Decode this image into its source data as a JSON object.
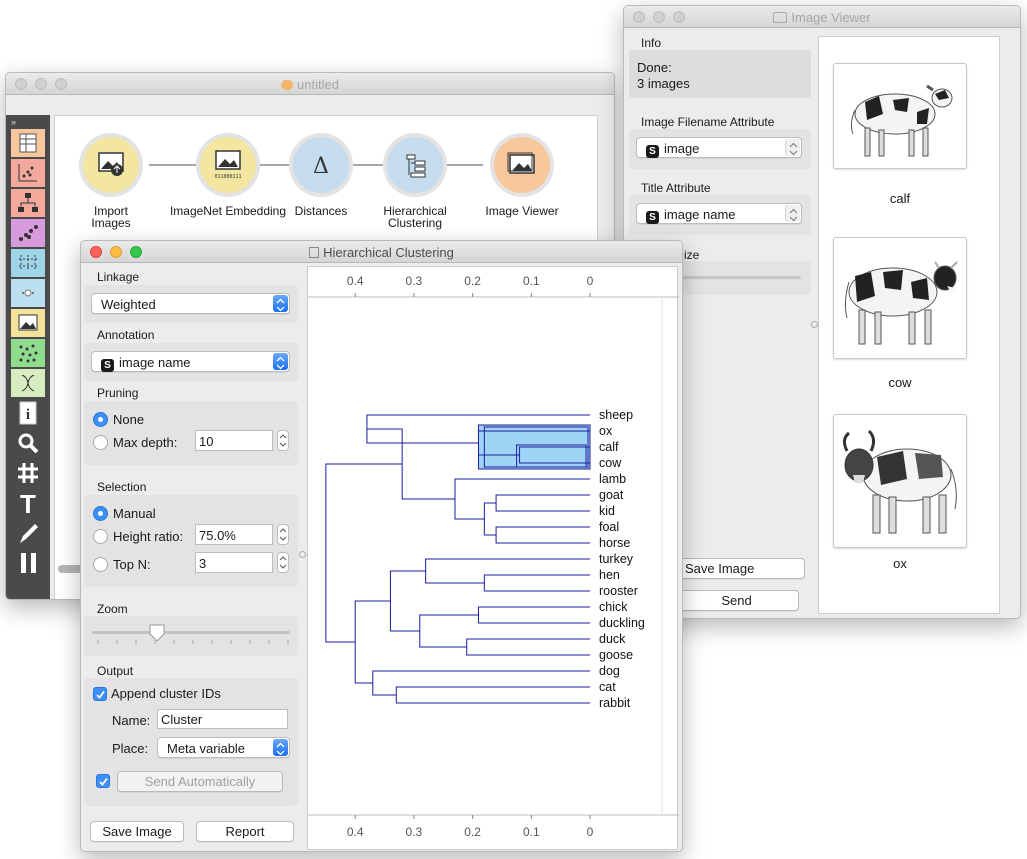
{
  "canvas_window": {
    "title": "untitled",
    "nodes": [
      {
        "label": "Import Images"
      },
      {
        "label": "ImageNet Embedding"
      },
      {
        "label": "Distances"
      },
      {
        "label": "Hierarchical\nClustering"
      },
      {
        "label": "Image Viewer"
      }
    ],
    "toolbox_icons": [
      "data-table-icon",
      "scatter-plot-icon",
      "tree-icon",
      "scatter-icon",
      "grid-icon",
      "dots-icon",
      "image-icon",
      "network-icon",
      "dna-icon",
      "info-icon",
      "zoom-icon",
      "grid-hash-icon",
      "text-icon",
      "pen-icon",
      "pause-icon"
    ]
  },
  "image_viewer": {
    "title": "Image Viewer",
    "info_label": "Info",
    "info_line1": "Done:",
    "info_line2": "3 images",
    "filename_attr_label": "Image Filename Attribute",
    "filename_attr_value": "image",
    "title_attr_label": "Title Attribute",
    "title_attr_value": "image name",
    "size_label_partial": "ize",
    "save_image": "Save Image",
    "send": "Send",
    "images": [
      {
        "caption": "calf"
      },
      {
        "caption": "cow"
      },
      {
        "caption": "ox"
      }
    ]
  },
  "hc_window": {
    "title": "Hierarchical Clustering",
    "linkage_label": "Linkage",
    "linkage_value": "Weighted",
    "annotation_label": "Annotation",
    "annotation_value": "image name",
    "pruning_label": "Pruning",
    "pruning_none": "None",
    "pruning_maxdepth": "Max depth:",
    "pruning_maxdepth_value": "10",
    "selection_label": "Selection",
    "sel_manual": "Manual",
    "sel_height_ratio": "Height ratio:",
    "sel_height_ratio_value": "75.0%",
    "sel_top_n": "Top N:",
    "sel_top_n_value": "3",
    "zoom_label": "Zoom",
    "zoom_level": 0.33,
    "output_label": "Output",
    "append_cluster_ids": "Append cluster IDs",
    "name_label": "Name:",
    "name_value": "Cluster",
    "place_label": "Place:",
    "place_value": "Meta variable",
    "send_automatically": "Send Automatically",
    "save_image": "Save Image",
    "report": "Report",
    "axis_ticks": [
      "0.4",
      "0.3",
      "0.2",
      "0.1",
      "0"
    ],
    "leaves": [
      "sheep",
      "ox",
      "calf",
      "cow",
      "lamb",
      "goat",
      "kid",
      "foal",
      "horse",
      "turkey",
      "hen",
      "rooster",
      "chick",
      "duckling",
      "duck",
      "goose",
      "dog",
      "cat",
      "rabbit"
    ],
    "selected_leaves": [
      "ox",
      "calf",
      "cow"
    ],
    "colors": {
      "tree": "#1d1d9e",
      "selection": "#9ed4f5",
      "accent": "#3b8ff6"
    }
  }
}
